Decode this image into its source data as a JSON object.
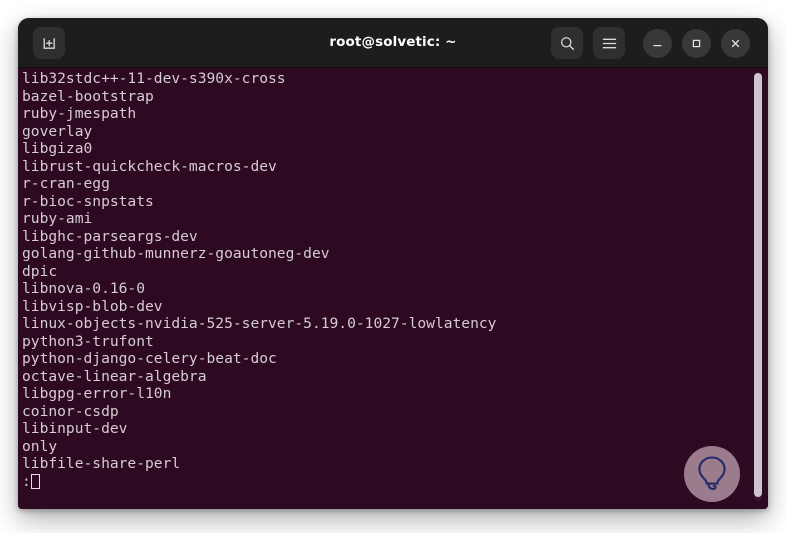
{
  "window": {
    "title": "root@solvetic: ~",
    "titlebar_color": "#1d1d1d",
    "terminal_bg": "#2d0922",
    "terminal_fg": "#d6cdd0",
    "desktop_bg": "#ffffff"
  },
  "titlebar": {
    "new_tab_icon": "new-tab-icon",
    "search_icon": "search-icon",
    "menu_icon": "hamburger-menu-icon",
    "minimize_icon": "minimize-icon",
    "maximize_icon": "maximize-icon",
    "close_icon": "close-icon"
  },
  "terminal": {
    "lines": [
      "lib32stdc++-11-dev-s390x-cross",
      "bazel-bootstrap",
      "ruby-jmespath",
      "goverlay",
      "libgiza0",
      "librust-quickcheck-macros-dev",
      "r-cran-egg",
      "r-bioc-snpstats",
      "ruby-ami",
      "libghc-parseargs-dev",
      "golang-github-munnerz-goautoneg-dev",
      "dpic",
      "libnova-0.16-0",
      "libvisp-blob-dev",
      "linux-objects-nvidia-525-server-5.19.0-1027-lowlatency",
      "python3-trufont",
      "python-django-celery-beat-doc",
      "octave-linear-algebra",
      "libgpg-error-l10n",
      "coinor-csdp",
      "libinput-dev",
      "only",
      "libfile-share-perl"
    ],
    "prompt": ":",
    "cursor": "block-cursor",
    "scrollbar": "vertical-scrollbar"
  },
  "watermark": {
    "icon": "lightbulb-logo-icon",
    "circle_color": "#dec4ce",
    "glyph_color": "#262a6b"
  }
}
